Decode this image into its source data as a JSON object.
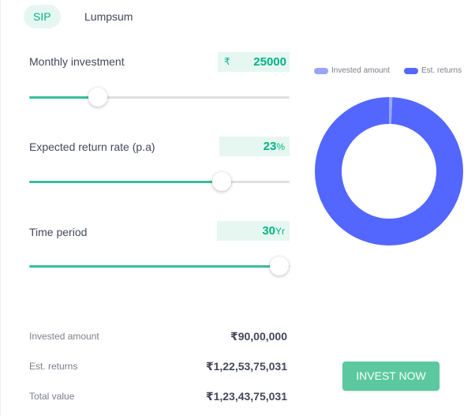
{
  "tabs": {
    "sip": "SIP",
    "lumpsum": "Lumpsum",
    "active": "SIP"
  },
  "monthly": {
    "label": "Monthly investment",
    "currency": "₹",
    "value": "25000",
    "slider_fraction": 0.265
  },
  "rate": {
    "label": "Expected return rate (p.a)",
    "value": "23",
    "unit": "%",
    "slider_fraction": 0.74
  },
  "period": {
    "label": "Time period",
    "value": "30",
    "unit": "Yr",
    "slider_fraction": 0.96
  },
  "summary": {
    "invested_label": "Invested amount",
    "invested_value": "₹90,00,000",
    "returns_label": "Est. returns",
    "returns_value": "₹1,22,53,75,031",
    "total_label": "Total value",
    "total_value": "₹1,23,43,75,031"
  },
  "legend": {
    "invested": "Invested amount",
    "invested_color": "#98a4ff",
    "returns": "Est. returns",
    "returns_color": "#5367ff"
  },
  "donut": {
    "invested": 9000000,
    "returns": 1225375031
  },
  "button": {
    "label": "INVEST NOW"
  },
  "colors": {
    "accent": "#00b386",
    "button": "#5bc8a0"
  }
}
